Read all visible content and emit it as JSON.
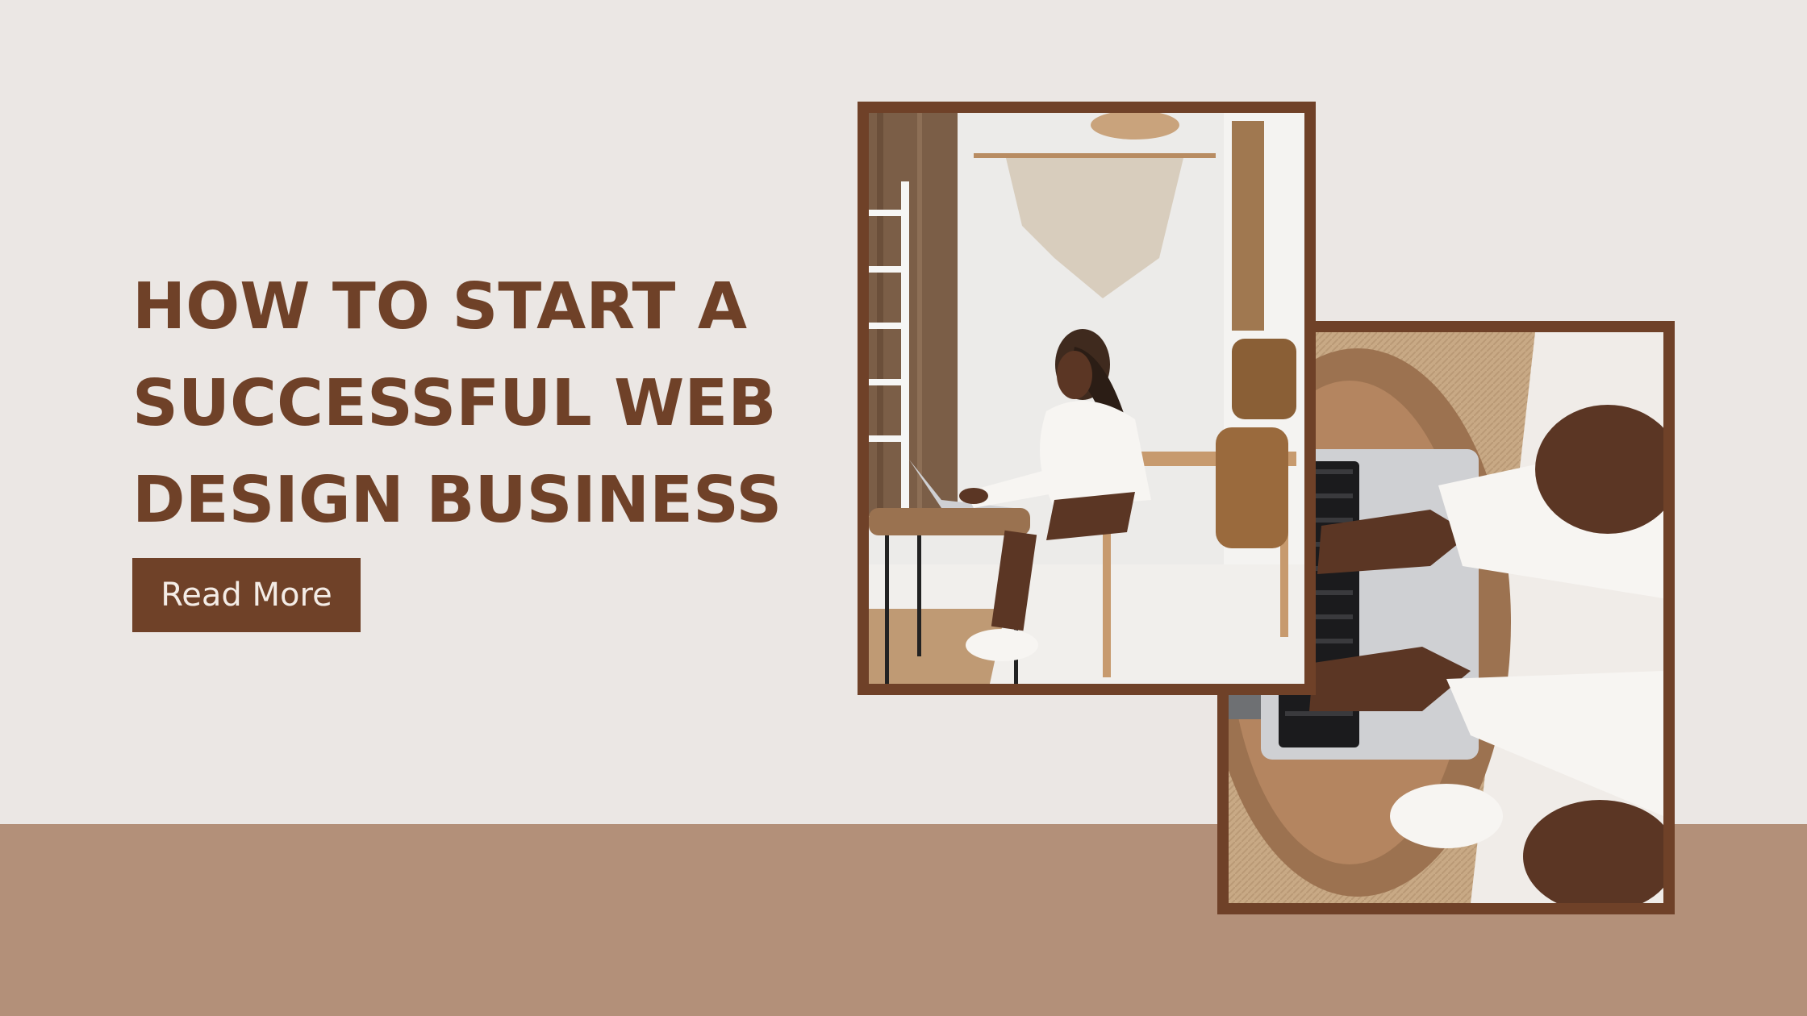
{
  "hero": {
    "title_lines": [
      "HOW TO START A",
      "SUCCESSFUL WEB",
      "DESIGN BUSINESS"
    ],
    "cta_label": "Read More"
  },
  "images": {
    "photo_1": "woman-working-on-laptop-in-chair",
    "photo_2": "hands-typing-on-laptop-keyboard"
  },
  "colors": {
    "background": "#ebe7e4",
    "accent_band": "#b39079",
    "brand_brown": "#6f4128"
  }
}
